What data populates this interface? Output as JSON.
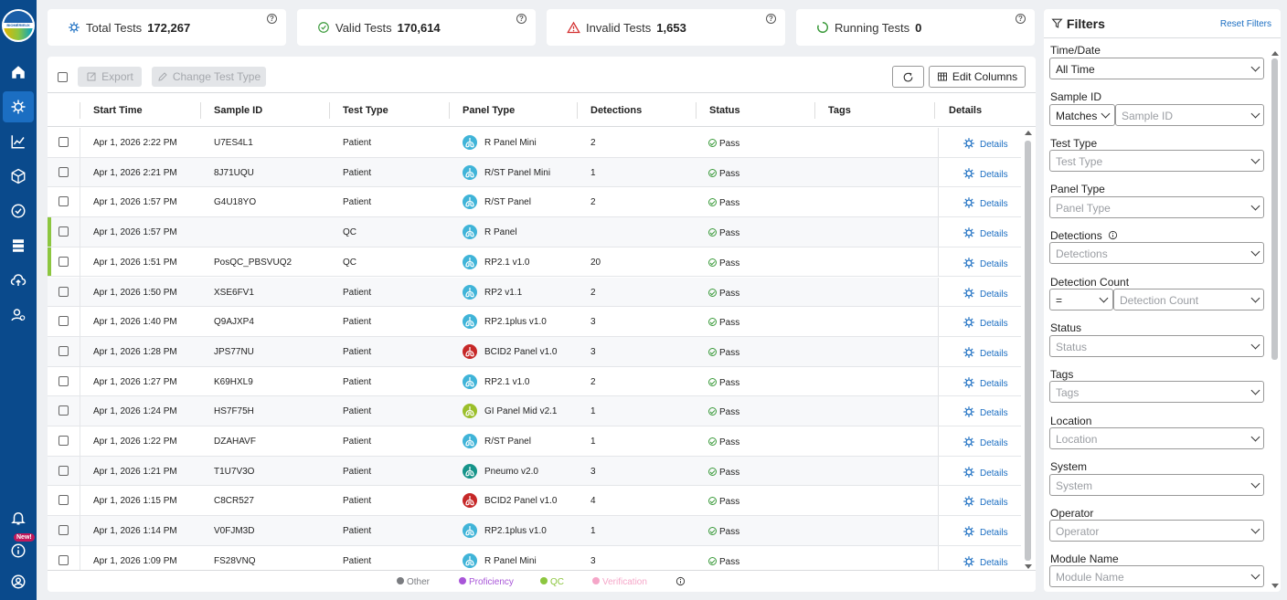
{
  "brand": {
    "logo_text": "BIOMÉRIEUX"
  },
  "sidebar": {
    "items": [
      {
        "icon": "home-icon",
        "name": "sidebar-item-home"
      },
      {
        "icon": "virus-icon",
        "name": "sidebar-item-tests"
      },
      {
        "icon": "chart-icon",
        "name": "sidebar-item-trends"
      },
      {
        "icon": "cube-icon",
        "name": "sidebar-item-inventory"
      },
      {
        "icon": "check-circle-icon",
        "name": "sidebar-item-verification"
      },
      {
        "icon": "server-icon",
        "name": "sidebar-item-systems"
      },
      {
        "icon": "cloud-upload-icon",
        "name": "sidebar-item-upload"
      },
      {
        "icon": "users-icon",
        "name": "sidebar-item-users"
      }
    ],
    "bottom": [
      {
        "icon": "bell-icon"
      },
      {
        "icon": "info-icon",
        "badge": "New!"
      },
      {
        "icon": "user-circle-icon"
      }
    ]
  },
  "stats": [
    {
      "label": "Total Tests",
      "value": "172,267",
      "icon": "virus-icon",
      "color": "#1b6ec2"
    },
    {
      "label": "Valid Tests",
      "value": "170,614",
      "icon": "check-circle-icon",
      "color": "#3a9a3a"
    },
    {
      "label": "Invalid Tests",
      "value": "1,653",
      "icon": "warning-icon",
      "color": "#d32f2f"
    },
    {
      "label": "Running Tests",
      "value": "0",
      "icon": "spinner-icon",
      "color": "#3a9a3a"
    }
  ],
  "toolbar": {
    "export_label": "Export",
    "change_type_label": "Change Test Type",
    "edit_columns_label": "Edit Columns"
  },
  "columns": [
    "Start Time",
    "Sample ID",
    "Test Type",
    "Panel Type",
    "Detections",
    "Status",
    "Tags",
    "Details"
  ],
  "rows": [
    {
      "time": "Apr 1, 2026 2:22 PM",
      "sample": "U7ES4L1",
      "type": "Patient",
      "panel": "R Panel Mini",
      "panel_color": "#40b4d8",
      "det": "2",
      "status": "Pass",
      "qc": false
    },
    {
      "time": "Apr 1, 2026 2:21 PM",
      "sample": "8J71UQU",
      "type": "Patient",
      "panel": "R/ST Panel Mini",
      "panel_color": "#40b4d8",
      "det": "1",
      "status": "Pass",
      "qc": false
    },
    {
      "time": "Apr 1, 2026 1:57 PM",
      "sample": "G4U18YO",
      "type": "Patient",
      "panel": "R/ST Panel",
      "panel_color": "#40b4d8",
      "det": "2",
      "status": "Pass",
      "qc": false
    },
    {
      "time": "Apr 1, 2026 1:57 PM",
      "sample": "",
      "type": "QC",
      "panel": "R Panel",
      "panel_color": "#40b4d8",
      "det": "",
      "status": "Pass",
      "qc": true
    },
    {
      "time": "Apr 1, 2026 1:51 PM",
      "sample": "PosQC_PBSVUQ2",
      "type": "QC",
      "panel": "RP2.1 v1.0",
      "panel_color": "#40b4d8",
      "det": "20",
      "status": "Pass",
      "qc": true
    },
    {
      "time": "Apr 1, 2026 1:50 PM",
      "sample": "XSE6FV1",
      "type": "Patient",
      "panel": "RP2 v1.1",
      "panel_color": "#40b4d8",
      "det": "2",
      "status": "Pass",
      "qc": false
    },
    {
      "time": "Apr 1, 2026 1:40 PM",
      "sample": "Q9AJXP4",
      "type": "Patient",
      "panel": "RP2.1plus v1.0",
      "panel_color": "#40b4d8",
      "det": "3",
      "status": "Pass",
      "qc": false
    },
    {
      "time": "Apr 1, 2026 1:28 PM",
      "sample": "JPS77NU",
      "type": "Patient",
      "panel": "BCID2 Panel v1.0",
      "panel_color": "#c62828",
      "det": "3",
      "status": "Pass",
      "qc": false
    },
    {
      "time": "Apr 1, 2026 1:27 PM",
      "sample": "K69HXL9",
      "type": "Patient",
      "panel": "RP2.1 v1.0",
      "panel_color": "#40b4d8",
      "det": "2",
      "status": "Pass",
      "qc": false
    },
    {
      "time": "Apr 1, 2026 1:24 PM",
      "sample": "HS7F75H",
      "type": "Patient",
      "panel": "GI Panel Mid v2.1",
      "panel_color": "#9bbf2a",
      "det": "1",
      "status": "Pass",
      "qc": false
    },
    {
      "time": "Apr 1, 2026 1:22 PM",
      "sample": "DZAHAVF",
      "type": "Patient",
      "panel": "R/ST Panel",
      "panel_color": "#40b4d8",
      "det": "1",
      "status": "Pass",
      "qc": false
    },
    {
      "time": "Apr 1, 2026 1:21 PM",
      "sample": "T1U7V3O",
      "type": "Patient",
      "panel": "Pneumo v2.0",
      "panel_color": "#16948a",
      "det": "3",
      "status": "Pass",
      "qc": false
    },
    {
      "time": "Apr 1, 2026 1:15 PM",
      "sample": "C8CR527",
      "type": "Patient",
      "panel": "BCID2 Panel v1.0",
      "panel_color": "#c62828",
      "det": "4",
      "status": "Pass",
      "qc": false
    },
    {
      "time": "Apr 1, 2026 1:14 PM",
      "sample": "V0FJM3D",
      "type": "Patient",
      "panel": "RP2.1plus v1.0",
      "panel_color": "#40b4d8",
      "det": "1",
      "status": "Pass",
      "qc": false
    },
    {
      "time": "Apr 1, 2026 1:09 PM",
      "sample": "FS28VNQ",
      "type": "Patient",
      "panel": "R Panel Mini",
      "panel_color": "#40b4d8",
      "det": "3",
      "status": "Pass",
      "qc": false
    }
  ],
  "details_label": "Details",
  "legend": [
    {
      "label": "Other",
      "color": "#7a7c80"
    },
    {
      "label": "Proficiency",
      "color": "#a855d8"
    },
    {
      "label": "QC",
      "color": "#8cc63f"
    },
    {
      "label": "Verification",
      "color": "#f5a6c8"
    }
  ],
  "filters": {
    "title": "Filters",
    "reset_label": "Reset Filters",
    "time_label": "Time/Date",
    "time_value": "All Time",
    "sample_label": "Sample ID",
    "sample_mode": "Matches",
    "sample_placeholder": "Sample ID",
    "test_type_label": "Test Type",
    "test_type_placeholder": "Test Type",
    "panel_label": "Panel Type",
    "panel_placeholder": "Panel Type",
    "detections_label": "Detections",
    "detections_placeholder": "Detections",
    "det_count_label": "Detection Count",
    "det_count_op": "=",
    "det_count_placeholder": "Detection Count",
    "status_label": "Status",
    "status_placeholder": "Status",
    "tags_label": "Tags",
    "tags_placeholder": "Tags",
    "location_label": "Location",
    "location_placeholder": "Location",
    "system_label": "System",
    "system_placeholder": "System",
    "operator_label": "Operator",
    "operator_placeholder": "Operator",
    "module_label": "Module Name",
    "module_placeholder": "Module Name"
  }
}
